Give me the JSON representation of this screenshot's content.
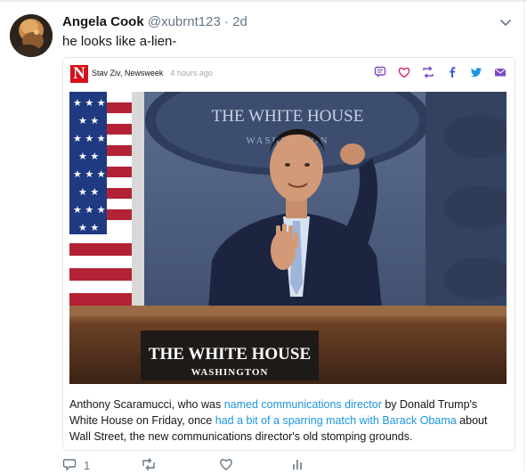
{
  "tweet": {
    "display_name": "Angela Cook",
    "handle": "@xubrnt123",
    "separator": "·",
    "time": "2d",
    "text": "he looks like a-lien-",
    "reply_count": "1"
  },
  "card": {
    "byline": "Stav Ziv, Newsweek",
    "time_ago": "4 hours ago",
    "image": {
      "seal_text": "THE WHITE HOUSE",
      "seal_subtext": "WASHINGTON",
      "podium_text": "THE WHITE HOUSE",
      "podium_subtext": "WASHINGTON"
    },
    "excerpt": {
      "part1": "Anthony Scaramucci, who was ",
      "link1": "named communications director",
      "part2": " by Donald Trump's White House on Friday, once ",
      "link2": "had a bit of a sparring match with Barack Obama",
      "part3": " about Wall Street, the new communications director's old stomping grounds."
    }
  },
  "colors": {
    "accent": "#1b95e0",
    "muted": "#657786",
    "newsweek_red": "#d6101b",
    "card_icon_purple": "#794bc4",
    "like_pink": "#e0245e",
    "retweet_green": "#17bf63"
  },
  "icons": {
    "comment": "comment-icon",
    "like": "heart-icon",
    "retweet": "retweet-icon",
    "facebook": "facebook-icon",
    "twitter": "twitter-bird-icon",
    "email": "email-icon",
    "menu": "chevron-down-icon"
  }
}
